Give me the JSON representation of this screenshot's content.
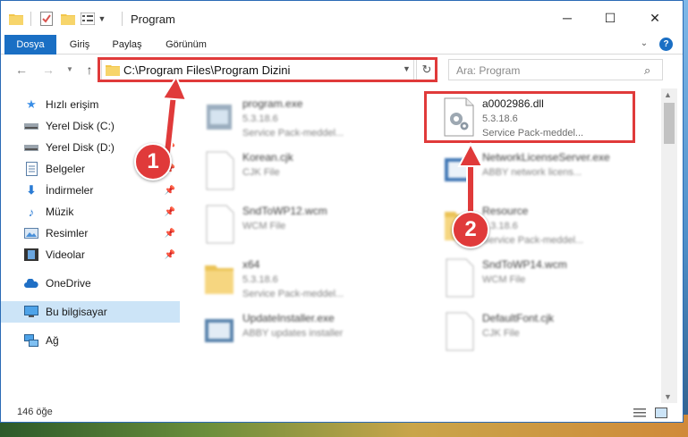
{
  "window": {
    "title": "Program"
  },
  "ribbon": {
    "tabs": [
      "Dosya",
      "Giriş",
      "Paylaş",
      "Görünüm"
    ]
  },
  "nav": {
    "address": "C:\\Program Files\\Program Dizini",
    "search_placeholder": "Ara: Program"
  },
  "sidebar": {
    "items": [
      {
        "label": "Hızlı erişim",
        "icon": "star-icon"
      },
      {
        "label": "Yerel Disk (C:)",
        "icon": "drive-icon"
      },
      {
        "label": "Yerel Disk (D:)",
        "icon": "drive-icon"
      },
      {
        "label": "Belgeler",
        "icon": "documents-icon"
      },
      {
        "label": "İndirmeler",
        "icon": "download-icon"
      },
      {
        "label": "Müzik",
        "icon": "music-icon"
      },
      {
        "label": "Resimler",
        "icon": "pictures-icon"
      },
      {
        "label": "Videolar",
        "icon": "videos-icon"
      },
      {
        "label": "OneDrive",
        "icon": "cloud-icon"
      },
      {
        "label": "Bu bilgisayar",
        "icon": "computer-icon"
      },
      {
        "label": "Ağ",
        "icon": "network-icon"
      }
    ]
  },
  "files": [
    {
      "name": "program.exe",
      "version": "5.3.18.6",
      "desc": "Service Pack-meddel..."
    },
    {
      "name": "a0002986.dll",
      "version": "5.3.18.6",
      "desc": "Service Pack-meddel..."
    },
    {
      "name": "Korean.cjk",
      "version": "CJK File",
      "desc": ""
    },
    {
      "name": "NetworkLicenseServer.exe",
      "version": "ABBY network licens...",
      "desc": ""
    },
    {
      "name": "SndToWP12.wcm",
      "version": "WCM File",
      "desc": ""
    },
    {
      "name": "Resource",
      "version": "5.3.18.6",
      "desc": "Service Pack-meddel..."
    },
    {
      "name": "x64",
      "version": "5.3.18.6",
      "desc": "Service Pack-meddel..."
    },
    {
      "name": "SndToWP14.wcm",
      "version": "WCM File",
      "desc": ""
    },
    {
      "name": "UpdateInstaller.exe",
      "version": "ABBY updates installer",
      "desc": ""
    },
    {
      "name": "DefaultFont.cjk",
      "version": "CJK File",
      "desc": ""
    }
  ],
  "status": {
    "count": "146 öğe"
  },
  "annotations": {
    "step1": "1",
    "step2": "2"
  },
  "colors": {
    "accent": "#1a6fc4",
    "highlight": "#e03a3a",
    "selection": "#cce4f7"
  }
}
